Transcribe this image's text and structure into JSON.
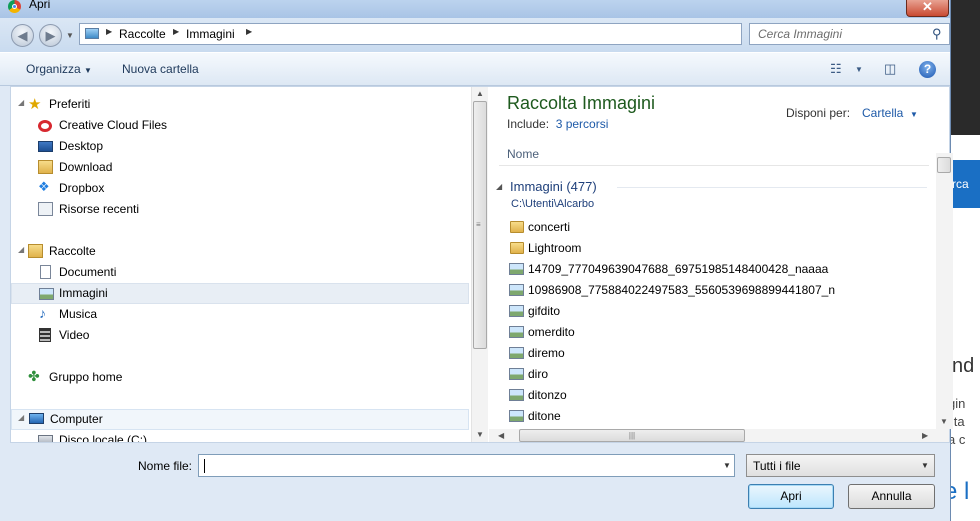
{
  "window": {
    "title": "Apri",
    "close_label": "✕"
  },
  "address": {
    "crumbs": [
      "Raccolte",
      "Immagini"
    ],
    "search_placeholder": "Cerca Immagini"
  },
  "toolbar": {
    "organize": "Organizza",
    "new_folder": "Nuova cartella",
    "help": "?"
  },
  "nav": {
    "favorites": "Preferiti",
    "fav_items": [
      "Creative Cloud Files",
      "Desktop",
      "Download",
      "Dropbox",
      "Risorse recenti"
    ],
    "libraries": "Raccolte",
    "lib_items": [
      "Documenti",
      "Immagini",
      "Musica",
      "Video"
    ],
    "homegroup": "Gruppo home",
    "computer": "Computer",
    "comp_items": [
      "Disco locale (C:)"
    ]
  },
  "library": {
    "title": "Raccolta Immagini",
    "includes_label": "Include:",
    "includes_link": "3 percorsi",
    "arrange_label": "Disponi per:",
    "arrange_value": "Cartella",
    "column_name": "Nome",
    "group_title": "Immagini (477)",
    "group_path": "C:\\Utenti\\Alcarbo",
    "files": [
      {
        "name": "concerti",
        "type": "folder"
      },
      {
        "name": "Lightroom",
        "type": "folder"
      },
      {
        "name": "14709_777049639047688_69751985148400428_naaaa",
        "type": "image"
      },
      {
        "name": "10986908_775884022497583_5560539698899441807_n",
        "type": "image"
      },
      {
        "name": "gifdito",
        "type": "image"
      },
      {
        "name": "omerdito",
        "type": "image"
      },
      {
        "name": "diremo",
        "type": "image"
      },
      {
        "name": "diro",
        "type": "image"
      },
      {
        "name": "ditonzo",
        "type": "image"
      },
      {
        "name": "ditone",
        "type": "image"
      }
    ]
  },
  "footer": {
    "filename_label": "Nome file:",
    "filename_value": "",
    "filetype": "Tutti i file",
    "open": "Apri",
    "cancel": "Annulla"
  },
  "background": {
    "blue_text": "rca",
    "heading_fragment": "nd",
    "lines": [
      "gin",
      "ilta",
      "a c"
    ],
    "link_fragment": "e l"
  },
  "colors": {
    "title_green": "#1e5a1e",
    "link_blue": "#1e5aa8",
    "accent": "#1a6fc4"
  }
}
